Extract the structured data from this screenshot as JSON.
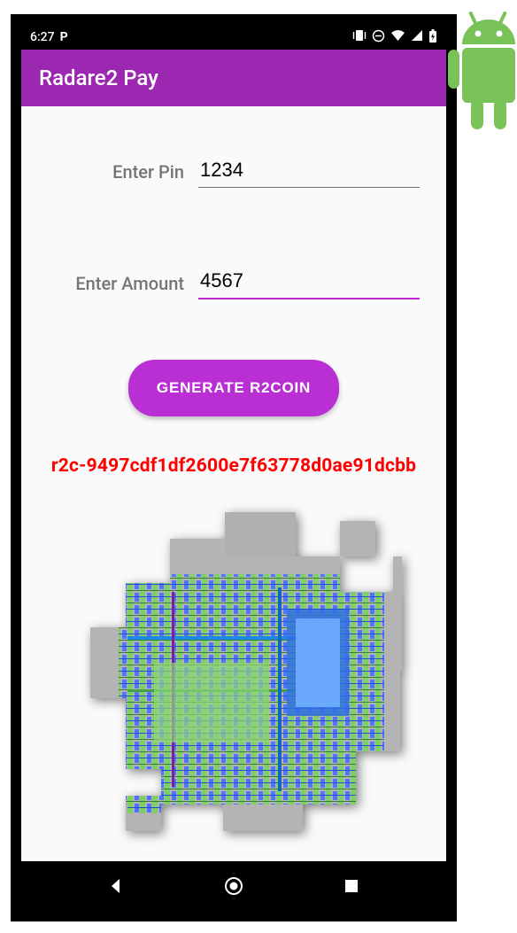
{
  "status": {
    "time": "6:27",
    "p_badge": "P"
  },
  "app": {
    "title": "Radare2 Pay"
  },
  "form": {
    "pin_label": "Enter Pin",
    "pin_value": "1234",
    "amount_label": "Enter Amount",
    "amount_value": "4567"
  },
  "action": {
    "button_label": "GENERATE R2COIN"
  },
  "result": {
    "code": "r2c-9497cdf1df2600e7f63778d0ae91dcbb"
  }
}
